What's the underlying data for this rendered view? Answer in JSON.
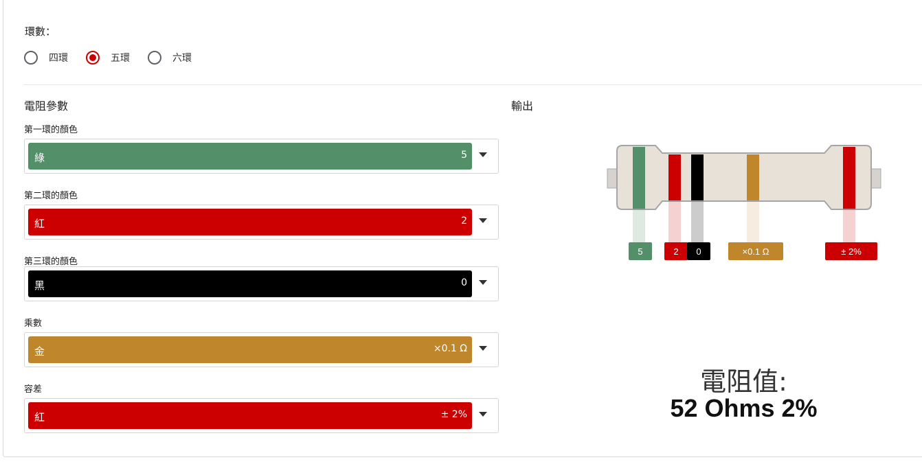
{
  "rings": {
    "label": "環數：",
    "options": [
      {
        "label": "四環",
        "selected": false
      },
      {
        "label": "五環",
        "selected": true
      },
      {
        "label": "六環",
        "selected": false
      }
    ]
  },
  "params": {
    "title": "電阻參數",
    "fields": [
      {
        "label": "第一環的顏色",
        "color_name": "綠",
        "value": "5",
        "color": "#53906a"
      },
      {
        "label": "第二環的顏色",
        "color_name": "紅",
        "value": "2",
        "color": "#cc0000"
      },
      {
        "label": "第三環的顏色",
        "color_name": "黑",
        "value": "0",
        "color": "#000000"
      },
      {
        "label": "乘數",
        "color_name": "金",
        "value": "×0.1 Ω",
        "color": "#c0862c"
      },
      {
        "label": "容差",
        "color_name": "紅",
        "value": "± 2%",
        "color": "#cc0000"
      }
    ]
  },
  "output": {
    "title": "輸出",
    "tags": [
      "5",
      "2",
      "0",
      "×0.1 Ω",
      "± 2%"
    ],
    "result_title": "電阻值:",
    "result_value": "52 Ohms 2%"
  }
}
